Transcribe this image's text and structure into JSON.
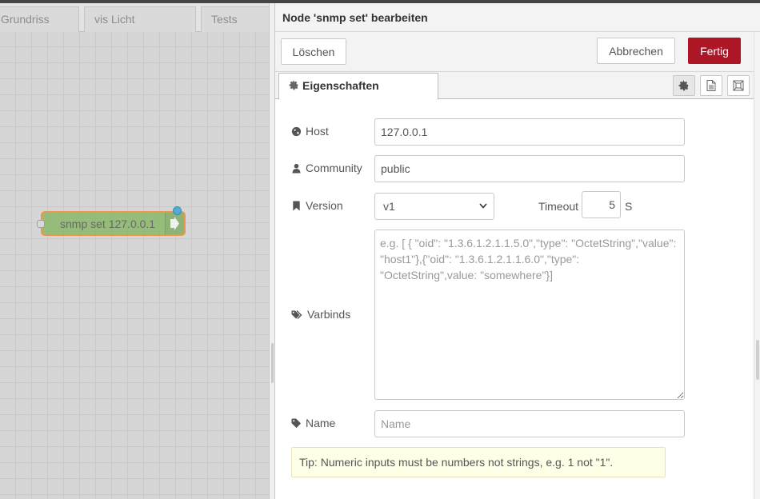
{
  "workspace": {
    "tabs": [
      {
        "label": "Grundriss"
      },
      {
        "label": "vis Licht"
      },
      {
        "label": "Tests"
      }
    ],
    "node": {
      "label": "snmp set 127.0.0.1"
    }
  },
  "editor": {
    "title": "Node 'snmp set' bearbeiten",
    "delete_label": "Löschen",
    "cancel_label": "Abbrechen",
    "done_label": "Fertig",
    "tab_properties": "Eigenschaften",
    "fields": {
      "host": {
        "label": "Host",
        "value": "127.0.0.1"
      },
      "community": {
        "label": "Community",
        "value": "public"
      },
      "version": {
        "label": "Version",
        "value": "v1"
      },
      "timeout": {
        "label": "Timeout",
        "value": "5",
        "unit": "S"
      },
      "varbinds": {
        "label": "Varbinds",
        "placeholder": "e.g. [ { \"oid\": \"1.3.6.1.2.1.1.5.0\",\"type\": \"OctetString\",\"value\": \"host1\"},{\"oid\": \"1.3.6.1.2.1.1.6.0\",\"type\": \"OctetString\",value: \"somewhere\"}]"
      },
      "name": {
        "label": "Name",
        "placeholder": "Name",
        "value": ""
      }
    },
    "tip": "Tip: Numeric inputs must be numbers not strings, e.g. 1 not \"1\"."
  },
  "colors": {
    "accent": "#ad1625",
    "node_fill": "#8cb86a",
    "node_border": "#ef8b3a",
    "status_dot": "#3ba7d7",
    "tip_bg": "#ffffe8"
  }
}
